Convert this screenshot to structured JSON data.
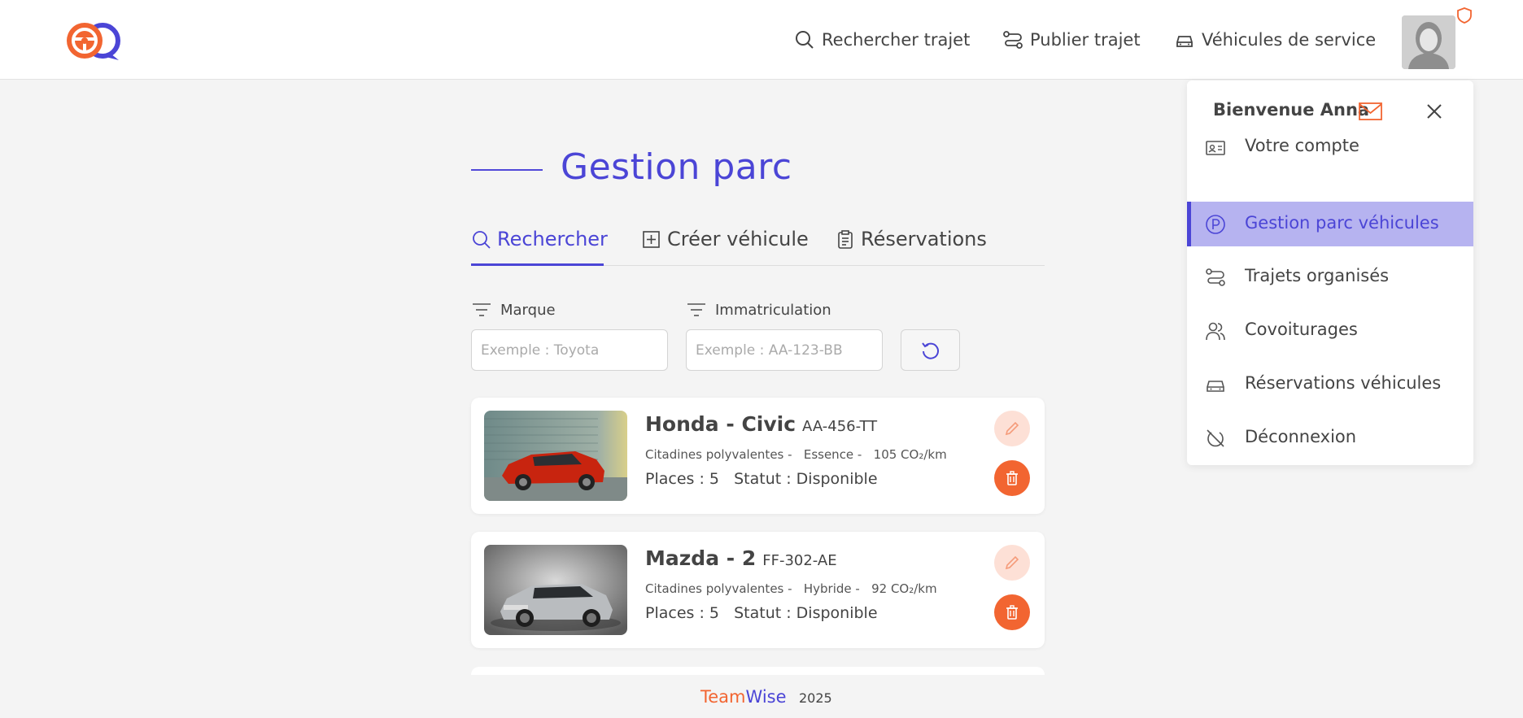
{
  "header": {
    "nav": [
      {
        "label": "Rechercher trajet",
        "icon": "search-icon"
      },
      {
        "label": "Publier trajet",
        "icon": "route-icon"
      },
      {
        "label": "Véhicules de service",
        "icon": "car-icon"
      }
    ]
  },
  "page": {
    "title": "Gestion parc",
    "tabs": [
      {
        "label": "Rechercher",
        "icon": "search-icon",
        "active": true
      },
      {
        "label": "Créer véhicule",
        "icon": "plus-square-icon",
        "active": false
      },
      {
        "label": "Réservations",
        "icon": "clipboard-icon",
        "active": false
      }
    ],
    "filters": {
      "brand": {
        "label": "Marque",
        "placeholder": "Exemple : Toyota",
        "value": ""
      },
      "plate": {
        "label": "Immatriculation",
        "placeholder": "Exemple : AA-123-BB",
        "value": ""
      }
    }
  },
  "vehicles": [
    {
      "name": "Honda - Civic",
      "plate": "AA-456-TT",
      "meta": "Citadines polyvalentes -   Essence -   105 CO₂/km",
      "info": "Places : 5   Statut : Disponible"
    },
    {
      "name": "Mazda - 2",
      "plate": "FF-302-AE",
      "meta": "Citadines polyvalentes -   Hybride -   92 CO₂/km",
      "info": "Places : 5   Statut : Disponible"
    }
  ],
  "menu": {
    "welcome": "Bienvenue Anna",
    "items": [
      {
        "label": "Votre compte",
        "icon": "id-card-icon"
      },
      {
        "label": "Gestion parc véhicules",
        "icon": "parking-icon",
        "active": true
      },
      {
        "label": "Trajets organisés",
        "icon": "route-icon"
      },
      {
        "label": "Covoiturages",
        "icon": "users-icon"
      },
      {
        "label": "Réservations véhicules",
        "icon": "car-icon"
      },
      {
        "label": "Déconnexion",
        "icon": "power-off-icon"
      }
    ]
  },
  "footer": {
    "brand_team": "Team",
    "brand_wise": "Wise",
    "year": "2025"
  },
  "colors": {
    "primary": "#4b45d6",
    "accent": "#f26531",
    "menu_active_bg": "#b6b3f0"
  }
}
